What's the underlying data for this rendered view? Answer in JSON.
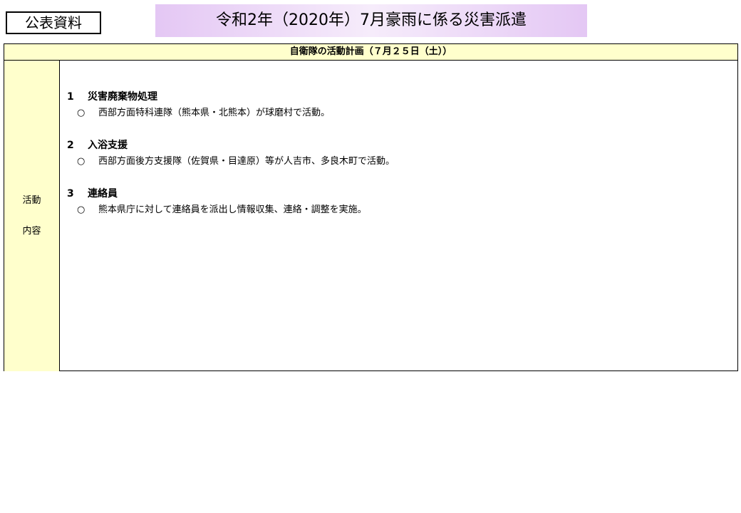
{
  "badge": "公表資料",
  "title": "令和2年（2020年）7月豪雨に係る災害派遣",
  "table": {
    "header": "自衛隊の活動計画（７月２５日（土））",
    "label": [
      "活動",
      "内容"
    ],
    "sections": [
      {
        "num": "1",
        "heading": "災害廃棄物処理",
        "bullet": "○",
        "text": "西部方面特科連隊（熊本県・北熊本）が球磨村で活動。"
      },
      {
        "num": "2",
        "heading": "入浴支援",
        "bullet": "○",
        "text": "西部方面後方支援隊（佐賀県・目達原）等が人吉市、多良木町で活動。"
      },
      {
        "num": "3",
        "heading": "連絡員",
        "bullet": "○",
        "text": "熊本県庁に対して連絡員を派出し情報収集、連絡・調整を実施。"
      }
    ]
  }
}
